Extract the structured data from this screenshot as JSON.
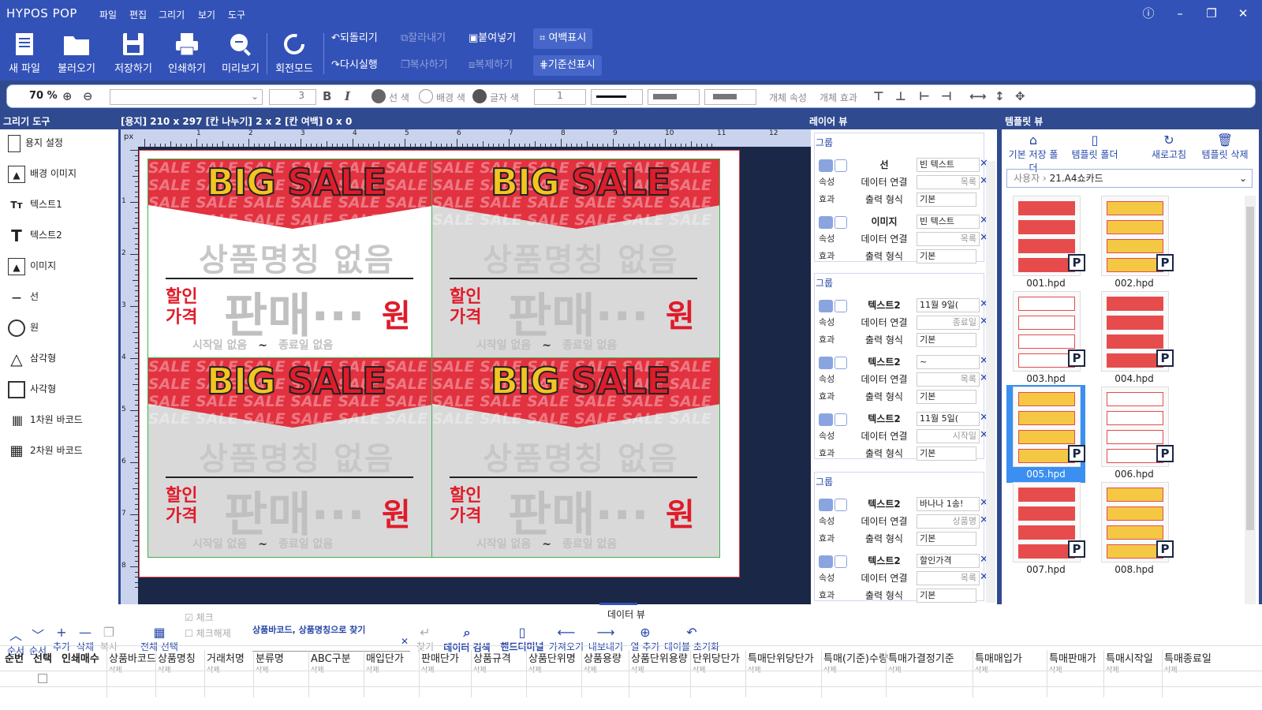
{
  "title": "HYPOS POP",
  "menu": [
    "파일",
    "편집",
    "그리기",
    "보기",
    "도구"
  ],
  "ribbon": {
    "big": [
      "새 파일",
      "불러오기",
      "저장하기",
      "인쇄하기",
      "미리보기",
      "회전모드"
    ],
    "undo": "되돌리기",
    "redo": "다시실행",
    "cut": "잘라내기",
    "paste": "붙여넣기",
    "copy": "복사하기",
    "dup": "복제하기",
    "margin": "여백표시",
    "guide": "기준선표시"
  },
  "format": {
    "zoom": "70 %",
    "font_size": "3",
    "line_color": "선 색",
    "bg_color": "배경 색",
    "text_color": "글자 색",
    "line_width": "1",
    "obj_prop": "개체 속성",
    "obj_effect": "개체 효과"
  },
  "tools": {
    "header": "그리기 도구",
    "items": [
      "용지 설정",
      "배경 이미지",
      "텍스트1",
      "텍스트2",
      "이미지",
      "선",
      "원",
      "삼각형",
      "사각형",
      "1차원 바코드",
      "2차원 바코드"
    ]
  },
  "canvas": {
    "info": "[용지] 210 x 297  [칸 나누기] 2 x 2  [칸 여백] 0 x 0",
    "unit": "px",
    "ruler": [
      "1",
      "2",
      "3",
      "4",
      "5",
      "6",
      "7",
      "8",
      "9",
      "10",
      "11",
      "12"
    ],
    "vruler": [
      "1",
      "2",
      "3",
      "4",
      "5",
      "6",
      "7",
      "8"
    ],
    "pop": {
      "sale1": "BIG",
      "sale2": "SALE",
      "name": "상품명칭 없음",
      "disc": "할인 가격",
      "price": "판매···",
      "won": "원",
      "start": "시작일 없음",
      "tilde": "~",
      "end": "종료일 없음",
      "bg_word": "SALE"
    }
  },
  "layer": {
    "header": "레이어 뷰",
    "group": "그룹",
    "prop": "속성",
    "effect": "효과",
    "link": "데이터 연결",
    "fmt": "출력 형식",
    "items": [
      {
        "type": "선",
        "val": "빈 텍스트",
        "link": "목록",
        "fmt": "기본"
      },
      {
        "type": "이미지",
        "val": "빈 텍스트",
        "link": "목록",
        "fmt": "기본"
      },
      {
        "type": "텍스트2",
        "val": "11월 9일(",
        "link": "종료일",
        "fmt": "기본"
      },
      {
        "type": "텍스트2",
        "val": "~",
        "link": "목록",
        "fmt": "기본"
      },
      {
        "type": "텍스트2",
        "val": "11월 5일(",
        "link": "시작일",
        "fmt": "기본"
      },
      {
        "type": "텍스트2",
        "val": "바나나 1송!",
        "link": "상품명",
        "fmt": "기본"
      },
      {
        "type": "텍스트2",
        "val": "할인가격",
        "link": "목록",
        "fmt": "기본"
      }
    ]
  },
  "template": {
    "header": "템플릿 뷰",
    "btns": [
      "기본 저장 폴더",
      "템플릿 폴더",
      "새로고침",
      "템플릿 삭제"
    ],
    "path_root": "사용자",
    "path_leaf": "21.A4쇼카드",
    "files": [
      "001.hpd",
      "002.hpd",
      "003.hpd",
      "004.hpd",
      "005.hpd",
      "006.hpd",
      "007.hpd",
      "008.hpd"
    ],
    "badge": "P"
  },
  "dataview": {
    "title": "데이터 뷰",
    "btns": [
      "순서",
      "순서",
      "추가",
      "삭제",
      "복사"
    ],
    "select_all": "전체 선택",
    "check": "체크",
    "uncheck": "체크해제",
    "search_label": "상품바코드, 상품명칭으로 찾기",
    "search_value": "",
    "find": "찾기",
    "tools": [
      "데이터 검색",
      "핸드터미널",
      "가져오기",
      "내보내기",
      "열 추가",
      "테이블 초기화"
    ],
    "fixed_cols": [
      "순번",
      "선택",
      "인쇄매수"
    ],
    "cols": [
      "상품바코드",
      "상품명칭",
      "거래처명",
      "분류명",
      "ABC구분",
      "매입단가",
      "판매단가",
      "상품규격",
      "상품단위명",
      "상품용량",
      "상품단위용량",
      "단위당단가",
      "특매단위당단가",
      "특매(기준)수량",
      "특매가결정기준",
      "특매매입가",
      "특매판매가",
      "특매시작일",
      "특매종료일"
    ],
    "del": "삭제"
  }
}
